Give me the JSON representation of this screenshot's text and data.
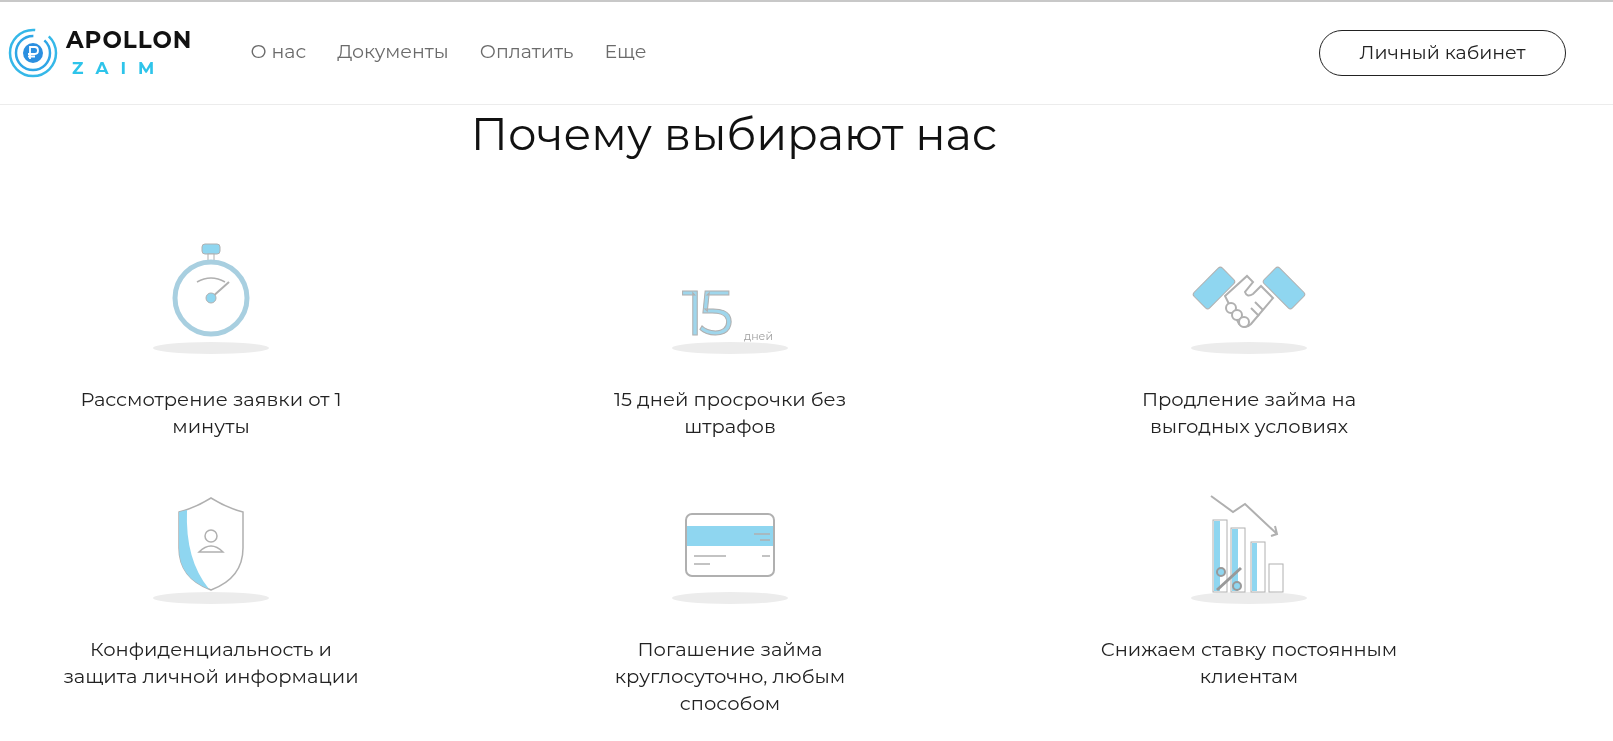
{
  "header": {
    "logo": {
      "word": "APOLLON",
      "sub": "ZAIM"
    },
    "nav": [
      {
        "label": "О нас"
      },
      {
        "label": "Документы"
      },
      {
        "label": "Оплатить"
      },
      {
        "label": "Еще"
      }
    ],
    "account_button": "Личный кабинет"
  },
  "title": "Почему выбирают нас",
  "features": [
    {
      "kind": "stopwatch",
      "text": "Рассмотрение заявки от 1 минуты"
    },
    {
      "kind": "days",
      "number": "15",
      "unit": "дней",
      "text": "15 дней просрочки без штрафов"
    },
    {
      "kind": "handshake",
      "text": "Продление займа на выгодных условиях"
    },
    {
      "kind": "shield",
      "text": "Конфиденциальность и защита личной информации"
    },
    {
      "kind": "card",
      "text": "Погашение займа круглосуточно, любым способом"
    },
    {
      "kind": "chart",
      "text": "Снижаем ставку постоянным клиентам"
    }
  ]
}
